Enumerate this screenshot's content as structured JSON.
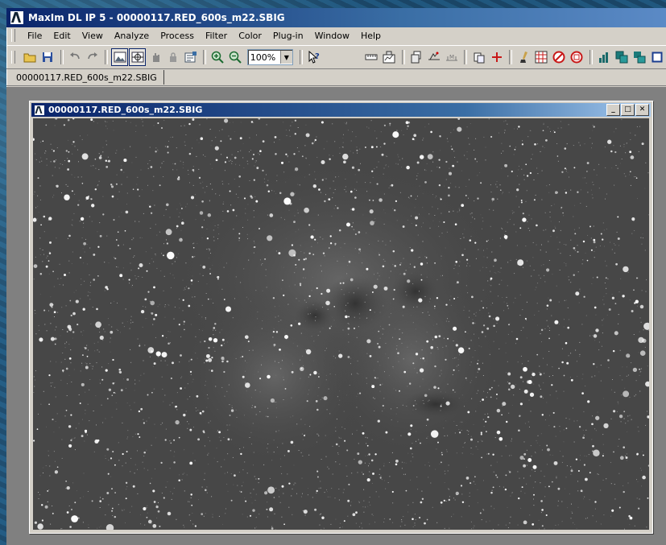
{
  "app": {
    "title": "MaxIm DL IP 5 - 00000117.RED_600s_m22.SBIG"
  },
  "menubar": {
    "items": [
      {
        "label": "File"
      },
      {
        "label": "Edit"
      },
      {
        "label": "View"
      },
      {
        "label": "Analyze"
      },
      {
        "label": "Process"
      },
      {
        "label": "Filter"
      },
      {
        "label": "Color"
      },
      {
        "label": "Plug-in"
      },
      {
        "label": "Window"
      },
      {
        "label": "Help"
      }
    ]
  },
  "toolbar": {
    "zoom_value": "100%",
    "icons": [
      "open-folder-icon",
      "save-disk-icon",
      "undo-icon",
      "redo-icon",
      "screen-stretch-icon",
      "crosshair-select-icon",
      "pan-hand-icon",
      "lock-icon",
      "information-icon",
      "zoom-in-icon",
      "zoom-out-icon",
      "help-pointer-icon",
      "ruler-icon",
      "line-profile-icon",
      "stack-icon",
      "align-icon",
      "measure-icon",
      "copy-icon",
      "crosshair-red-icon",
      "brush-icon",
      "grid-icon",
      "no-entry-icon",
      "hot-pixel-icon",
      "histogram-icon",
      "overlay-icon",
      "window-tile-icon",
      "square-icon"
    ]
  },
  "document_tab": {
    "label": "00000117.RED_600s_m22.SBIG"
  },
  "image_window": {
    "title": "00000117.RED_600s_m22.SBIG",
    "minimize_glyph": "_",
    "maximize_glyph": "□",
    "close_glyph": "✕"
  },
  "colors": {
    "title_active": "#0a246a",
    "window_face": "#d4d0c8",
    "mdi_background": "#808080",
    "image_sky": "#474747"
  }
}
